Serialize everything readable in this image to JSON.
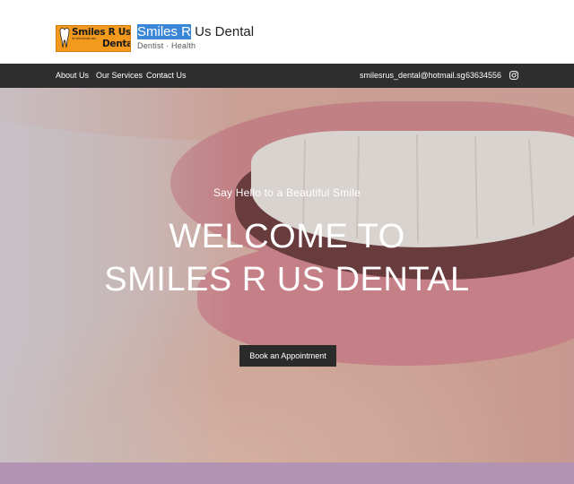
{
  "header": {
    "logo": {
      "line1": "Smiles R Us",
      "line2": "for total dental care",
      "line3": "Dental"
    },
    "brand_highlight": "Smiles R",
    "brand_rest": " Us Dental",
    "tagline": "Dentist · Health"
  },
  "nav": {
    "items": [
      "About Us",
      "Our Services",
      "Contact Us"
    ],
    "email": "smilesrus_dental@hotmail.sg",
    "phone": "63634556",
    "social_icon": "instagram-icon"
  },
  "hero": {
    "subtitle": "Say Hello to a Beautiful Smile",
    "title_line1": "WELCOME TO",
    "title_line2": "SMILES R US DENTAL",
    "cta": "Book an Appointment"
  },
  "colors": {
    "nav_bg": "#2e2e2e",
    "button_bg": "#2b2b2b",
    "highlight": "#3a87d8",
    "logo_bg": "#f39a1e",
    "bottom_band": "#b393b3"
  }
}
